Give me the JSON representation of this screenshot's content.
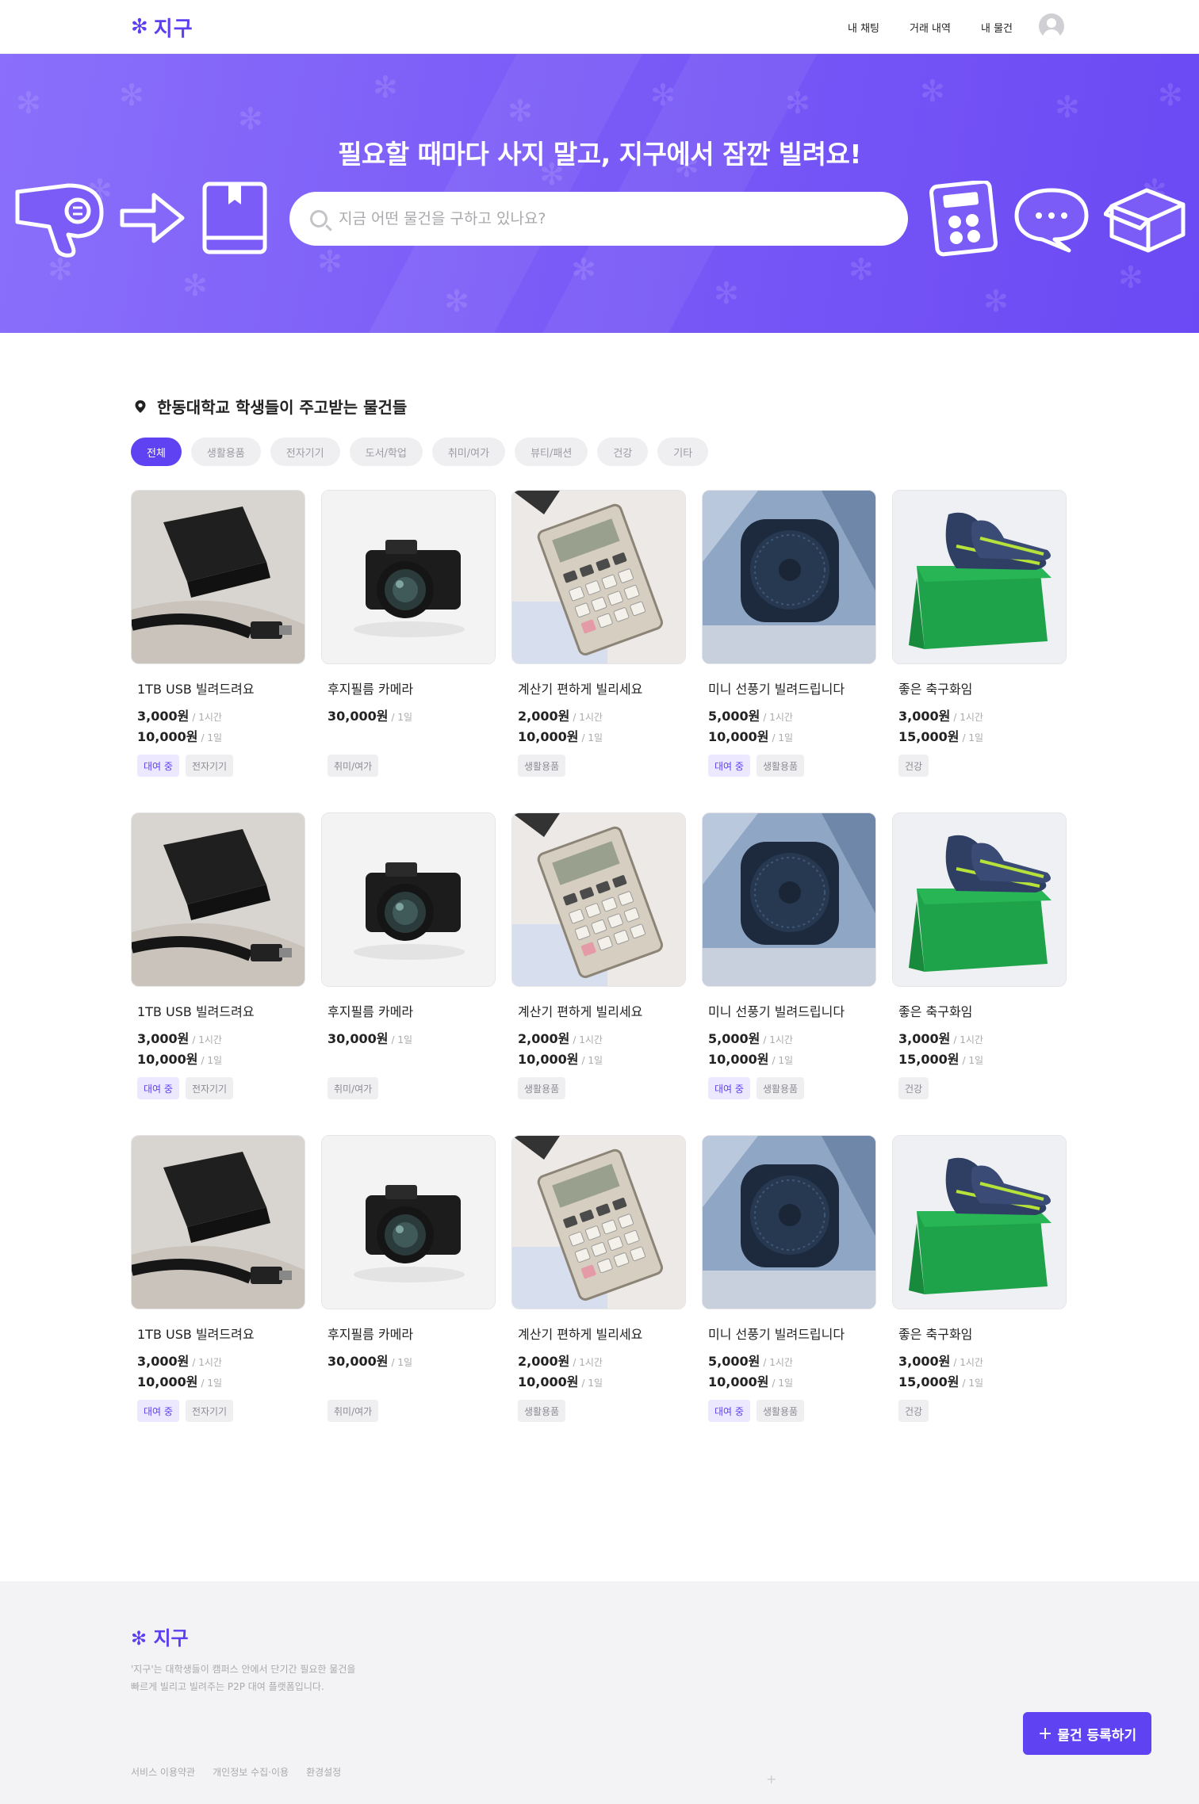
{
  "header": {
    "logo_mark": "✻",
    "logo_text": "지구",
    "nav": [
      "내 채팅",
      "거래 내역",
      "내 물건"
    ]
  },
  "hero": {
    "title": "필요할 때마다 사지 말고, 지구에서 잠깐 빌려요!",
    "search_placeholder": "지금 어떤 물건을 구하고 있나요?",
    "icons": [
      "hair-dryer-icon",
      "arrow-right-icon",
      "book-icon",
      "calculator-icon",
      "chat-bubble-icon",
      "box-icon"
    ]
  },
  "section": {
    "title": "한동대학교 학생들이 주고받는 물건들",
    "categories": [
      "전체",
      "생활용품",
      "전자기기",
      "도서/학업",
      "취미/여가",
      "뷰티/패션",
      "건강",
      "기타"
    ],
    "active_category": "전체"
  },
  "products": [
    {
      "title": "1TB USB 빌려드려요",
      "image": "charger",
      "prices": [
        {
          "amount": "3,000원",
          "unit": "/ 1시간"
        },
        {
          "amount": "10,000원",
          "unit": "/ 1일"
        }
      ],
      "tags": [
        {
          "label": "대여 중",
          "rent": true
        },
        {
          "label": "전자기기",
          "rent": false
        }
      ]
    },
    {
      "title": "후지필름 카메라",
      "image": "camera",
      "prices": [
        {
          "amount": "30,000원",
          "unit": "/ 1일"
        }
      ],
      "tags": [
        {
          "label": "취미/여가",
          "rent": false
        }
      ]
    },
    {
      "title": "계산기 편하게 빌리세요",
      "image": "calculator",
      "prices": [
        {
          "amount": "2,000원",
          "unit": "/ 1시간"
        },
        {
          "amount": "10,000원",
          "unit": "/ 1일"
        }
      ],
      "tags": [
        {
          "label": "생활용품",
          "rent": false
        }
      ]
    },
    {
      "title": "미니 선풍기 빌려드립니다",
      "image": "fan",
      "prices": [
        {
          "amount": "5,000원",
          "unit": "/ 1시간"
        },
        {
          "amount": "10,000원",
          "unit": "/ 1일"
        }
      ],
      "tags": [
        {
          "label": "대여 중",
          "rent": true
        },
        {
          "label": "생활용품",
          "rent": false
        }
      ]
    },
    {
      "title": "좋은 축구화임",
      "image": "shoes",
      "prices": [
        {
          "amount": "3,000원",
          "unit": "/ 1시간"
        },
        {
          "amount": "15,000원",
          "unit": "/ 1일"
        }
      ],
      "tags": [
        {
          "label": "건강",
          "rent": false
        }
      ]
    }
  ],
  "footer": {
    "logo_text": "지구",
    "description_line1": "'지구'는 대학생들이 캠퍼스 안에서 단기간 필요한 물건을",
    "description_line2": "빠르게 빌리고 빌려주는 P2P 대여 플랫폼입니다.",
    "links": [
      "서비스 이용약관",
      "개인정보 수집·이용",
      "환경설정"
    ]
  },
  "fab": {
    "label": "물건 등록하기"
  },
  "colors": {
    "accent": "#5f43f2",
    "hero": "#7b5cf7",
    "rent_tag_bg": "#ece8ff"
  }
}
